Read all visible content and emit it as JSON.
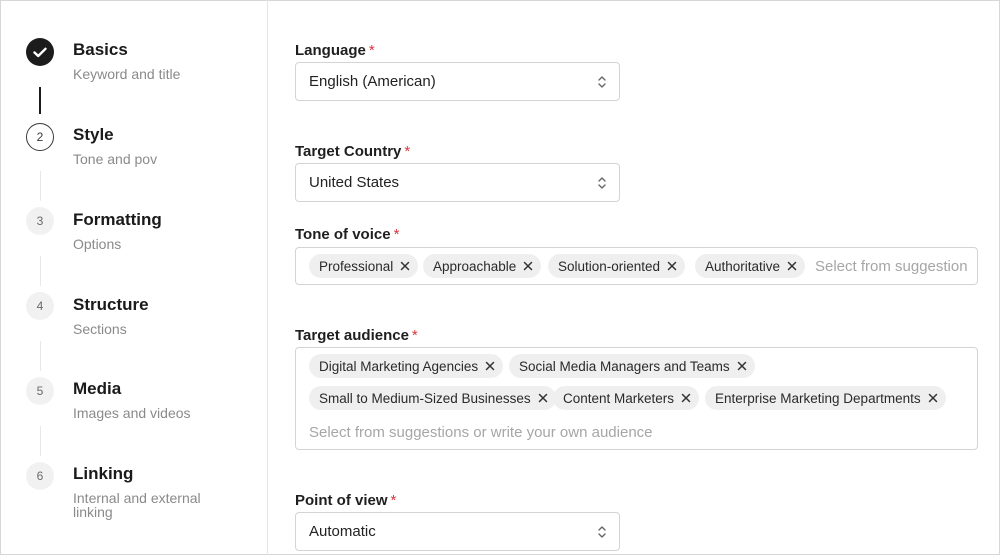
{
  "steps": [
    {
      "title": "Basics",
      "subtitle": "Keyword and title",
      "state": "done",
      "icon": "check-icon"
    },
    {
      "title": "Style",
      "subtitle": "Tone and pov",
      "number": "2",
      "state": "current"
    },
    {
      "title": "Formatting",
      "subtitle": "Options",
      "number": "3",
      "state": "todo"
    },
    {
      "title": "Structure",
      "subtitle": "Sections",
      "number": "4",
      "state": "todo"
    },
    {
      "title": "Media",
      "subtitle": "Images and videos",
      "number": "5",
      "state": "todo"
    },
    {
      "title": "Linking",
      "subtitle": "Internal and external linking",
      "number": "6",
      "state": "todo"
    }
  ],
  "form": {
    "language": {
      "label": "Language",
      "required": "*",
      "value": "English (American)",
      "icon": "chevron-updown-icon"
    },
    "target_country": {
      "label": "Target Country",
      "required": "*",
      "value": "United States",
      "icon": "chevron-updown-icon"
    },
    "tone_of_voice": {
      "label": "Tone of voice",
      "required": "*",
      "tags": [
        "Professional",
        "Approachable",
        "Solution-oriented",
        "Authoritative"
      ],
      "placeholder": "Select from suggestions"
    },
    "target_audience": {
      "label": "Target audience",
      "required": "*",
      "tags": [
        "Digital Marketing Agencies",
        "Social Media Managers and Teams",
        "Small to Medium-Sized Businesses",
        "Content Marketers",
        "Enterprise Marketing Departments"
      ],
      "placeholder": "Select from suggestions or write your own audience"
    },
    "point_of_view": {
      "label": "Point of view",
      "required": "*",
      "value": "Automatic",
      "icon": "chevron-updown-icon"
    }
  },
  "colors": {
    "accent": "#1c1c1c",
    "required": "#d9363e",
    "tag_bg": "#efefef",
    "border": "#d4d4d4"
  }
}
